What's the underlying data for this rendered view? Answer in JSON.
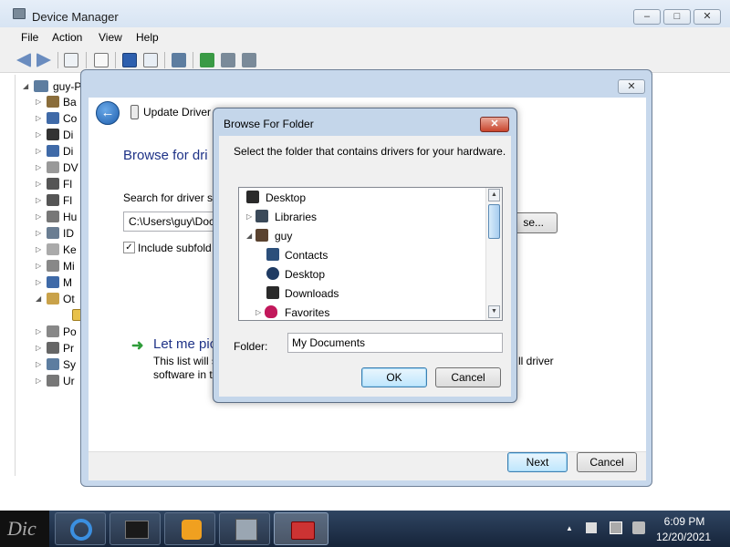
{
  "device_manager": {
    "title": "Device Manager",
    "window_controls": [
      "–",
      "□",
      "✕"
    ],
    "menu": [
      "File",
      "Action",
      "View",
      "Help"
    ],
    "tree_root": "guy-P",
    "tree_items": [
      "Ba",
      "Co",
      "Di",
      "Di",
      "DV",
      "Fl",
      "Fl",
      "Hu",
      "ID",
      "Ke",
      "Mi",
      "M",
      "Ot",
      "",
      "Po",
      "Pr",
      "Sy",
      "Ur"
    ]
  },
  "wizard": {
    "title": "Update Driver S",
    "close": "✕",
    "back_glyph": "←",
    "heading": "Browse for dri",
    "search_label": "Search for driver so",
    "path_value": "C:\\Users\\guy\\Doc",
    "browse_button": "se...",
    "checkbox_checked": "✓",
    "checkbox_label": "Include subfold",
    "pick_arrow": "➜",
    "pick_title": "Let me pic",
    "pick_desc1": "This list will s",
    "pick_desc1_tail": "ll driver",
    "pick_desc2": "software in t",
    "next_button": "Next",
    "cancel_button": "Cancel"
  },
  "browse_folder": {
    "title": "Browse For Folder",
    "close": "✕",
    "instruction": "Select the folder that contains drivers for your hardware.",
    "tree": [
      {
        "label": "Desktop",
        "level": 0,
        "expander": "",
        "icon": "desktop-icon"
      },
      {
        "label": "Libraries",
        "level": 0,
        "expander": "▷",
        "icon": "libraries-icon"
      },
      {
        "label": "guy",
        "level": 0,
        "expander": "◢",
        "icon": "user-folder-icon"
      },
      {
        "label": "Contacts",
        "level": 1,
        "expander": "",
        "icon": "contacts-icon"
      },
      {
        "label": "Desktop",
        "level": 1,
        "expander": "",
        "icon": "desktop-icon"
      },
      {
        "label": "Downloads",
        "level": 1,
        "expander": "",
        "icon": "downloads-icon"
      },
      {
        "label": "Favorites",
        "level": 1,
        "expander": "▷",
        "icon": "favorites-icon"
      }
    ],
    "scroll_up": "▲",
    "scroll_down": "▼",
    "folder_label": "Folder:",
    "folder_value": "My Documents",
    "ok_button": "OK",
    "cancel_button": "Cancel"
  },
  "taskbar": {
    "start_label": "Dic",
    "time": "6:09 PM",
    "date": "12/20/2021",
    "tray_up": "▲",
    "apps": [
      "internet-explorer-icon",
      "device-manager-app-icon",
      "media-player-icon",
      "hardware-icon",
      "toolbox-icon"
    ]
  },
  "colors": {
    "accent_blue": "#1e3287",
    "taskbar": "#1c2c45",
    "close_red": "#c9452d"
  }
}
